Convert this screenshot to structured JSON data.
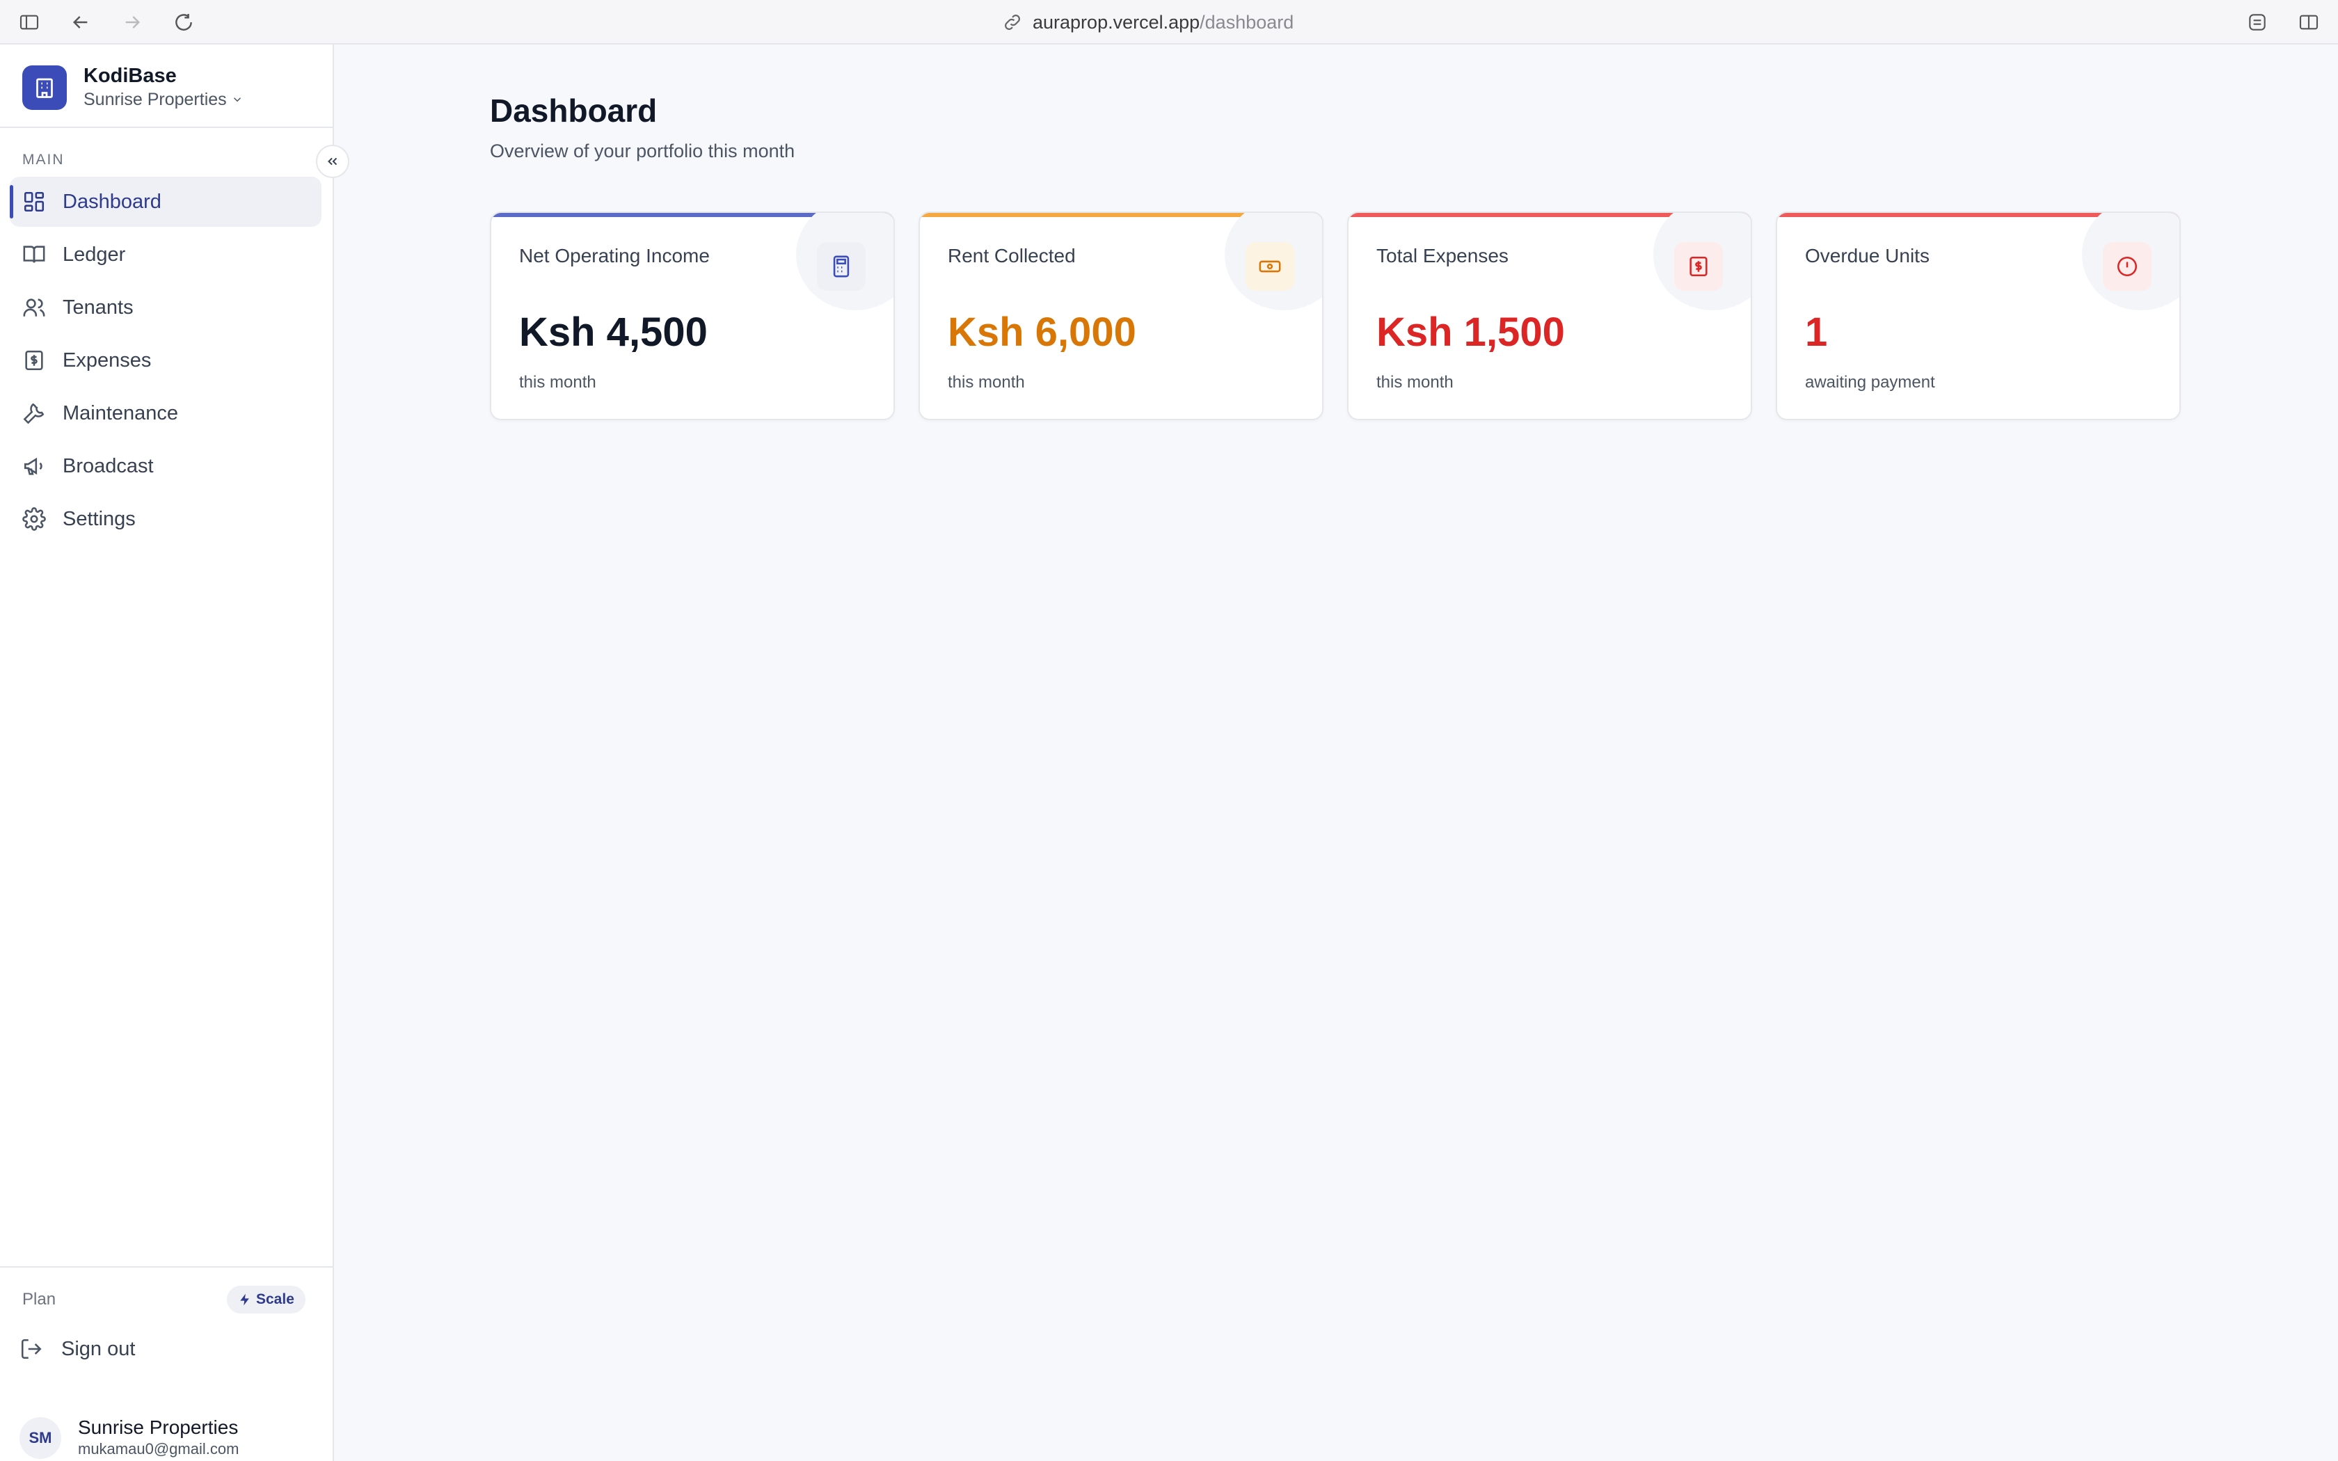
{
  "browser": {
    "url_host": "auraprop.vercel.app",
    "url_path": "/dashboard"
  },
  "sidebar": {
    "brand_name": "KodiBase",
    "org_name": "Sunrise Properties",
    "section_label": "MAIN",
    "items": [
      {
        "label": "Dashboard",
        "icon": "grid-icon",
        "active": true
      },
      {
        "label": "Ledger",
        "icon": "book-icon"
      },
      {
        "label": "Tenants",
        "icon": "users-icon"
      },
      {
        "label": "Expenses",
        "icon": "receipt-dollar-icon"
      },
      {
        "label": "Maintenance",
        "icon": "wrench-icon"
      },
      {
        "label": "Broadcast",
        "icon": "megaphone-icon"
      },
      {
        "label": "Settings",
        "icon": "gear-icon"
      }
    ],
    "plan_label": "Plan",
    "plan_badge": "Scale",
    "sign_out": "Sign out",
    "user": {
      "initials": "SM",
      "name": "Sunrise Properties",
      "email": "mukamau0@gmail.com"
    }
  },
  "main": {
    "title": "Dashboard",
    "subtitle": "Overview of your portfolio this month",
    "cards": [
      {
        "label": "Net Operating Income",
        "value": "Ksh 4,500",
        "caption": "this month",
        "accent": "#5b6bc7",
        "value_color": "#111827",
        "icon": "calculator-icon"
      },
      {
        "label": "Rent Collected",
        "value": "Ksh 6,000",
        "caption": "this month",
        "accent": "#f5a742",
        "value_color": "#d97706",
        "icon": "banknote-icon"
      },
      {
        "label": "Total Expenses",
        "value": "Ksh 1,500",
        "caption": "this month",
        "accent": "#ef5a5a",
        "value_color": "#dc2626",
        "icon": "receipt-icon"
      },
      {
        "label": "Overdue Units",
        "value": "1",
        "caption": "awaiting payment",
        "accent": "#ef5a5a",
        "value_color": "#dc2626",
        "icon": "alert-circle-icon"
      }
    ]
  }
}
